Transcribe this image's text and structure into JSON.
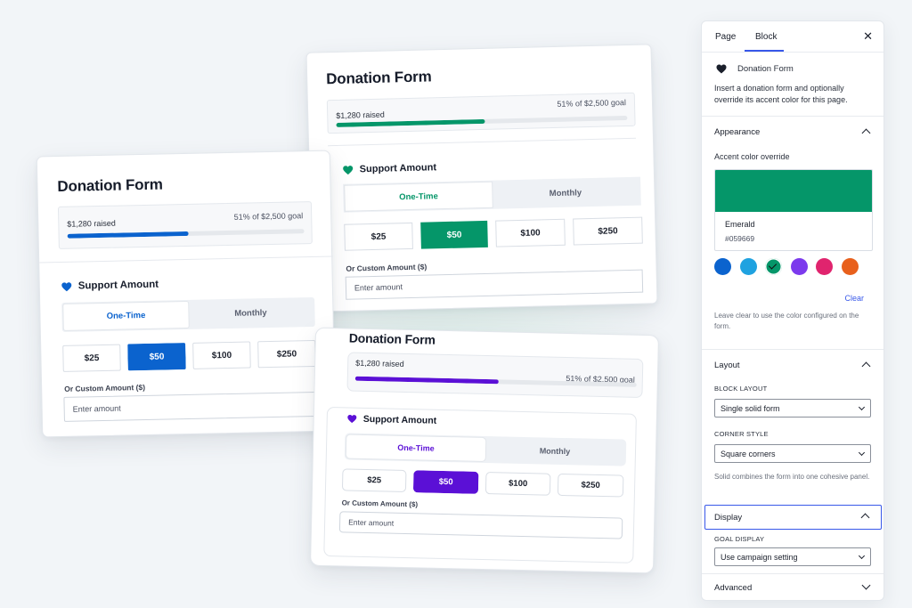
{
  "form": {
    "title": "Donation Form",
    "raised": "$1,280 raised",
    "goal_text": "51% of $2,500 goal",
    "progress_fraction": 0.51,
    "support_label": "Support Amount",
    "tabs": [
      "One-Time",
      "Monthly"
    ],
    "amounts": [
      "$25",
      "$50",
      "$100",
      "$250"
    ],
    "custom_label": "Or Custom Amount ($)",
    "custom_placeholder": "Enter amount"
  },
  "variants": {
    "left": {
      "accent": "#0b63ce"
    },
    "top": {
      "accent": "#059669"
    },
    "bottom": {
      "accent": "#5b10d6"
    }
  },
  "sidebar": {
    "tabs": [
      "Page",
      "Block"
    ],
    "active_tab": "Block",
    "close_icon": "close-icon",
    "block_name": "Donation Form",
    "block_icon": "heart-icon",
    "block_description": "Insert a donation form and optionally override its accent color for this page.",
    "appearance": {
      "heading": "Appearance",
      "accent_label": "Accent color override",
      "color_name": "Emerald",
      "color_hex": "#059669",
      "swatches": [
        "#0b63ce",
        "#1fa2e0",
        "#059669",
        "#7c3aed",
        "#e0246e",
        "#e8601c"
      ],
      "selected_swatch": 2,
      "clear_label": "Clear",
      "help": "Leave clear to use the color configured on the form."
    },
    "layout": {
      "heading": "Layout",
      "block_layout_label": "BLOCK LAYOUT",
      "block_layout_value": "Single solid form",
      "corner_label": "CORNER STYLE",
      "corner_value": "Square corners",
      "help": "Solid combines the form into one cohesive panel."
    },
    "display": {
      "heading": "Display",
      "goal_label": "GOAL DISPLAY",
      "goal_value": "Use campaign setting"
    },
    "advanced": {
      "heading": "Advanced"
    }
  }
}
